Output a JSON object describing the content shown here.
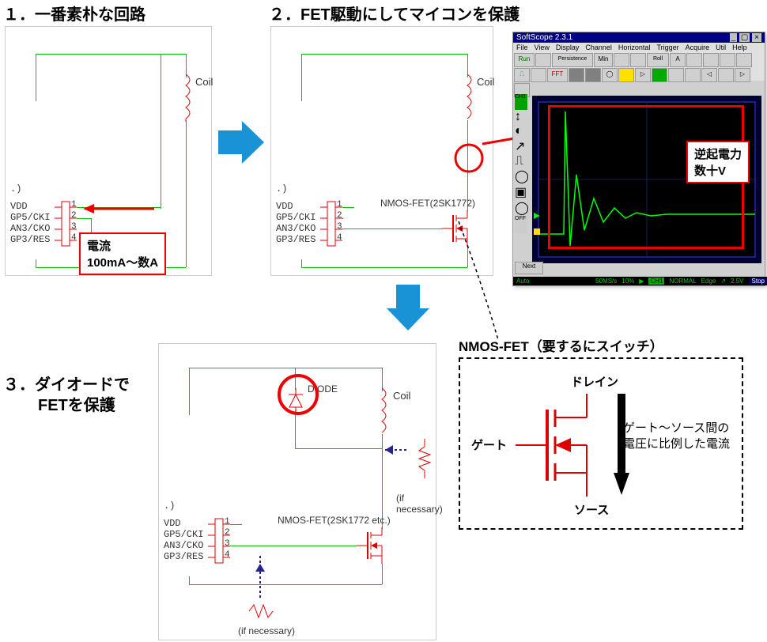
{
  "heading1": "１．一番素朴な回路",
  "heading2": "２．FET駆動にしてマイコンを保護",
  "heading3": "３．ダイオードで",
  "heading3b": "FETを保護",
  "coil_label": "Coil",
  "fet_label2": "NMOS-FET(2SK1772)",
  "fet_label3": "NMOS-FET(2SK1772 etc.)",
  "diode_label": "DIODE",
  "if_necessary": "(if necessary)",
  "pin_header": ".)",
  "pins": {
    "vdd": "VDD",
    "gp5": "GP5/CKI",
    "an3": "AN3/CKO",
    "gp3": "GP3/RES"
  },
  "pin_nums": {
    "p1": "1",
    "p2": "2",
    "p3": "3",
    "p4": "4"
  },
  "callout_current_l1": "電流",
  "callout_current_l2": "100mA〜数A",
  "callout_backemf_l1": "逆起電力",
  "callout_backemf_l2": "数十V",
  "nmos_box_title": "NMOS-FET（要するにスイッチ）",
  "nmos_drain": "ドレイン",
  "nmos_gate": "ゲート",
  "nmos_source": "ソース",
  "nmos_note_l1": "ゲート～ソース間の",
  "nmos_note_l2": "電圧に比例した電流",
  "scope_title": "SoftScope 2.3.1",
  "scope_menu": {
    "file": "File",
    "view": "View",
    "display": "Display",
    "channel": "Channel",
    "horizontal": "Horizontal",
    "trigger": "Trigger",
    "acquire": "Acquire",
    "util": "Util",
    "help": "Help"
  },
  "scope_tool_run": "Run",
  "scope_tool_min": "Min",
  "scope_status": {
    "auto": "Auto",
    "rate": "50MS/s",
    "pct": "10%",
    "ch": "CH1",
    "mode": "NORMAL",
    "edge": "Edge",
    "lvl": "2.5V",
    "stop": "Stop"
  },
  "scope_ctrl_next": "Next",
  "scope_ctrl_off": "OFF",
  "scope_ctrl_pers": "Persistence",
  "scope_ctrl_roll": "Roll",
  "icons": {
    "close": "×",
    "max": "▢",
    "min": "_",
    "fft": "FFT"
  }
}
